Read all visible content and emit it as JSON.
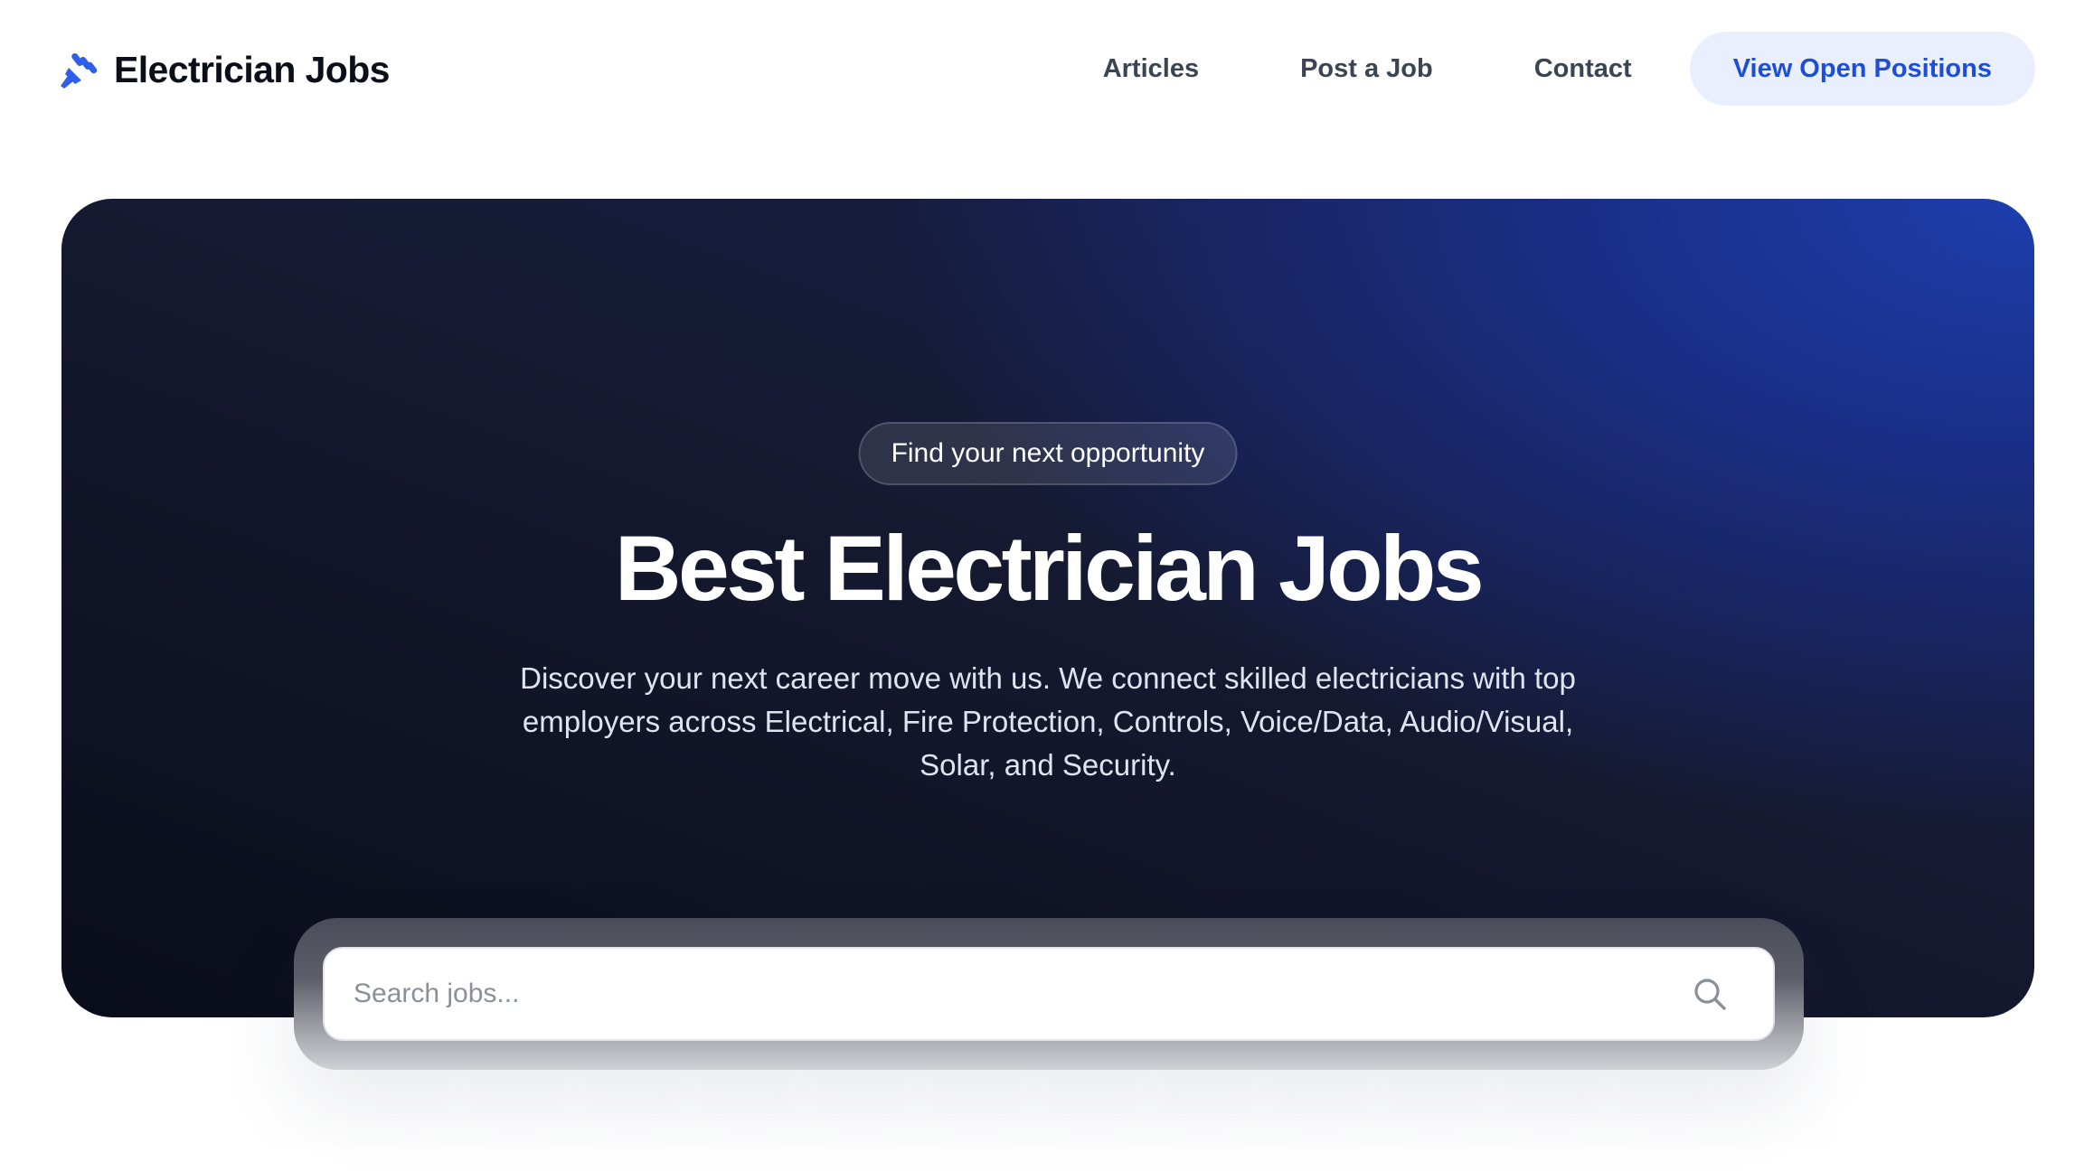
{
  "colors": {
    "brand_accent": "#2f5ee8",
    "nav_text": "#3b4452",
    "cta_bg": "#e9effd",
    "cta_text": "#1d4ed8",
    "hero_dark": "#0a0d19",
    "hero_blue": "#1d3ead"
  },
  "brand": {
    "icon": "plug-icon",
    "name": "Electrician Jobs"
  },
  "nav": {
    "links": [
      "Articles",
      "Post a Job",
      "Contact"
    ],
    "cta_label": "View Open Positions"
  },
  "hero": {
    "badge": "Find your next opportunity",
    "title": "Best Electrician Jobs",
    "description": "Discover your next career move with us. We connect skilled electricians with top employers across Electrical, Fire Protection, Controls, Voice/Data, Audio/Visual, Solar, and Security."
  },
  "search": {
    "placeholder": "Search jobs...",
    "value": "",
    "icon": "search-icon"
  }
}
